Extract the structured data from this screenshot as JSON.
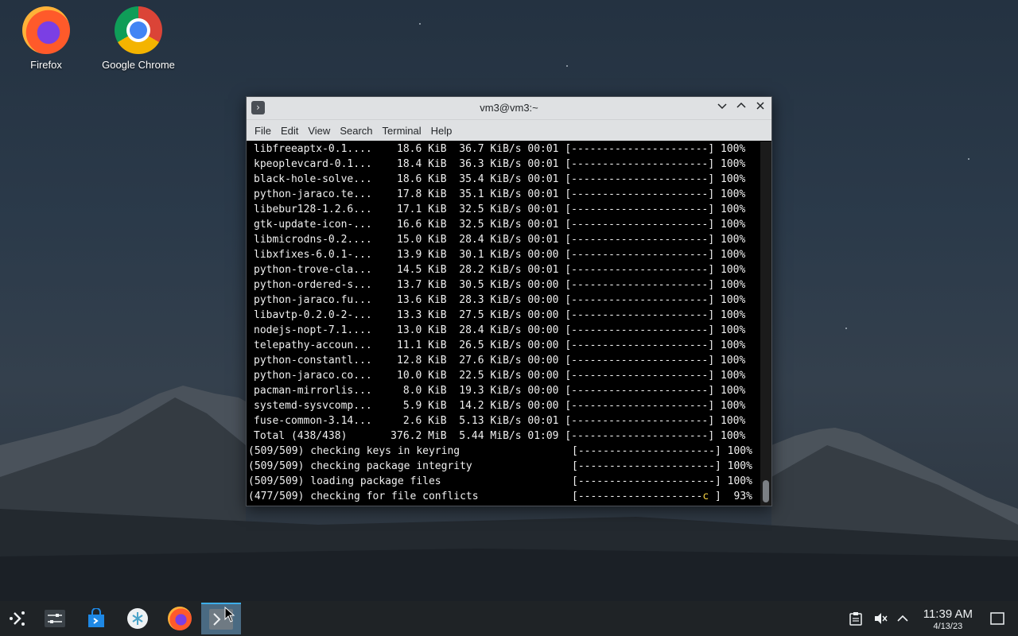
{
  "desktop": {
    "icons": [
      {
        "label": "Firefox",
        "icon": "firefox-icon"
      },
      {
        "label": "Google Chrome",
        "icon": "chrome-icon"
      }
    ]
  },
  "window": {
    "title": "vm3@vm3:~",
    "menu": [
      "File",
      "Edit",
      "View",
      "Search",
      "Terminal",
      "Help"
    ]
  },
  "terminal": {
    "lines": [
      "libfreeaptx-0.1....    18.6 KiB  36.7 KiB/s 00:01 [----------------------] 100%",
      "kpeoplevcard-0.1...    18.4 KiB  36.3 KiB/s 00:01 [----------------------] 100%",
      "black-hole-solve...    18.6 KiB  35.4 KiB/s 00:01 [----------------------] 100%",
      "python-jaraco.te...    17.8 KiB  35.1 KiB/s 00:01 [----------------------] 100%",
      "libebur128-1.2.6...    17.1 KiB  32.5 KiB/s 00:01 [----------------------] 100%",
      "gtk-update-icon-...    16.6 KiB  32.5 KiB/s 00:01 [----------------------] 100%",
      "libmicrodns-0.2....    15.0 KiB  28.4 KiB/s 00:01 [----------------------] 100%",
      "libxfixes-6.0.1-...    13.9 KiB  30.1 KiB/s 00:00 [----------------------] 100%",
      "python-trove-cla...    14.5 KiB  28.2 KiB/s 00:01 [----------------------] 100%",
      "python-ordered-s...    13.7 KiB  30.5 KiB/s 00:00 [----------------------] 100%",
      "python-jaraco.fu...    13.6 KiB  28.3 KiB/s 00:00 [----------------------] 100%",
      "libavtp-0.2.0-2-...    13.3 KiB  27.5 KiB/s 00:00 [----------------------] 100%",
      "nodejs-nopt-7.1....    13.0 KiB  28.4 KiB/s 00:00 [----------------------] 100%",
      "telepathy-accoun...    11.1 KiB  26.5 KiB/s 00:00 [----------------------] 100%",
      "python-constantl...    12.8 KiB  27.6 KiB/s 00:00 [----------------------] 100%",
      "python-jaraco.co...    10.0 KiB  22.5 KiB/s 00:00 [----------------------] 100%",
      "pacman-mirrorlis...     8.0 KiB  19.3 KiB/s 00:00 [----------------------] 100%",
      "systemd-sysvcomp...     5.9 KiB  14.2 KiB/s 00:00 [----------------------] 100%",
      "fuse-common-3.14...     2.6 KiB  5.13 KiB/s 00:01 [----------------------] 100%",
      "Total (438/438)       376.2 MiB  5.44 MiB/s 01:09 [----------------------] 100%"
    ],
    "status_lines": [
      "(509/509) checking keys in keyring                  [----------------------] 100%",
      "(509/509) checking package integrity                [----------------------] 100%",
      "(509/509) loading package files                     [----------------------] 100%"
    ],
    "last_line_prefix": "(477/509) checking for file conflicts               [--------------------",
    "last_line_cursor": "c",
    "last_line_suffix": " ]  93%"
  },
  "taskbar": {
    "items": [
      "application-launcher-icon",
      "system-settings-icon",
      "discover-store-icon",
      "kde-connect-icon",
      "firefox-icon",
      "terminal-icon"
    ],
    "tray": [
      "clipboard-icon",
      "volume-muted-icon",
      "expand-tray-icon"
    ],
    "time": "11:39 AM",
    "date": "4/13/23"
  },
  "colors": {
    "accent": "#3daee9",
    "cursor": "#f5d142"
  }
}
